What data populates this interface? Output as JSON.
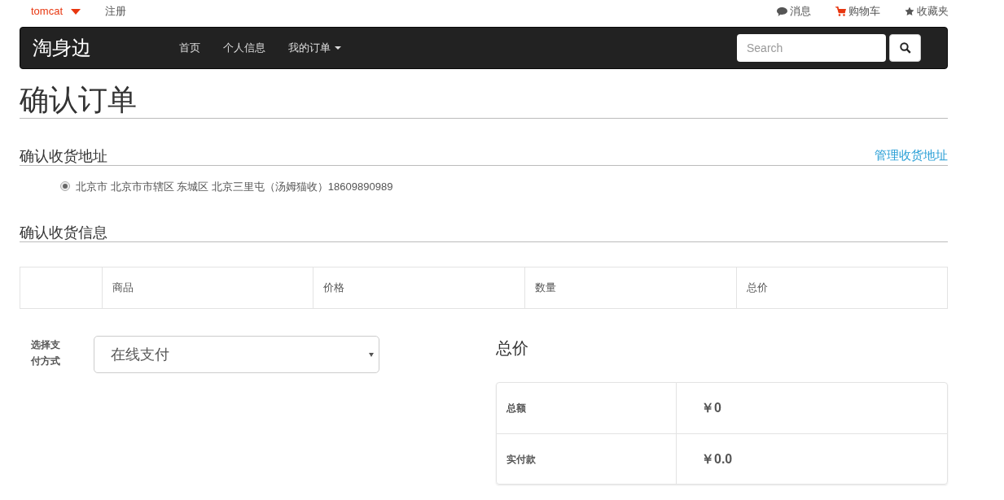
{
  "top_bar": {
    "user": "tomcat",
    "register": "注册",
    "links": [
      {
        "kind": "message",
        "label": "消息"
      },
      {
        "kind": "cart",
        "label": "购物车"
      },
      {
        "kind": "favorite",
        "label": "收藏夹"
      }
    ]
  },
  "navbar": {
    "brand": "淘身边",
    "items": [
      {
        "label": "首页",
        "dropdown": false
      },
      {
        "label": "个人信息",
        "dropdown": false
      },
      {
        "label": "我的订单",
        "dropdown": true
      }
    ],
    "search": {
      "placeholder": "Search"
    }
  },
  "page_title": "确认订单",
  "address_section": {
    "title": "确认收货地址",
    "manage_link": "管理收货地址",
    "addresses": [
      {
        "text": "北京市 北京市市辖区 东城区 北京三里屯（汤姆猫收）18609890989",
        "selected": true
      }
    ]
  },
  "info_section": {
    "title": "确认收货信息",
    "table": {
      "columns": [
        "",
        "商品",
        "价格",
        "数量",
        "总价"
      ]
    }
  },
  "payment": {
    "label": "选择支付方式",
    "value": "在线支付"
  },
  "total": {
    "title": "总价",
    "rows": [
      {
        "label": "总额",
        "value": "￥0"
      },
      {
        "label": "实付款",
        "value": "￥0.0"
      }
    ]
  }
}
